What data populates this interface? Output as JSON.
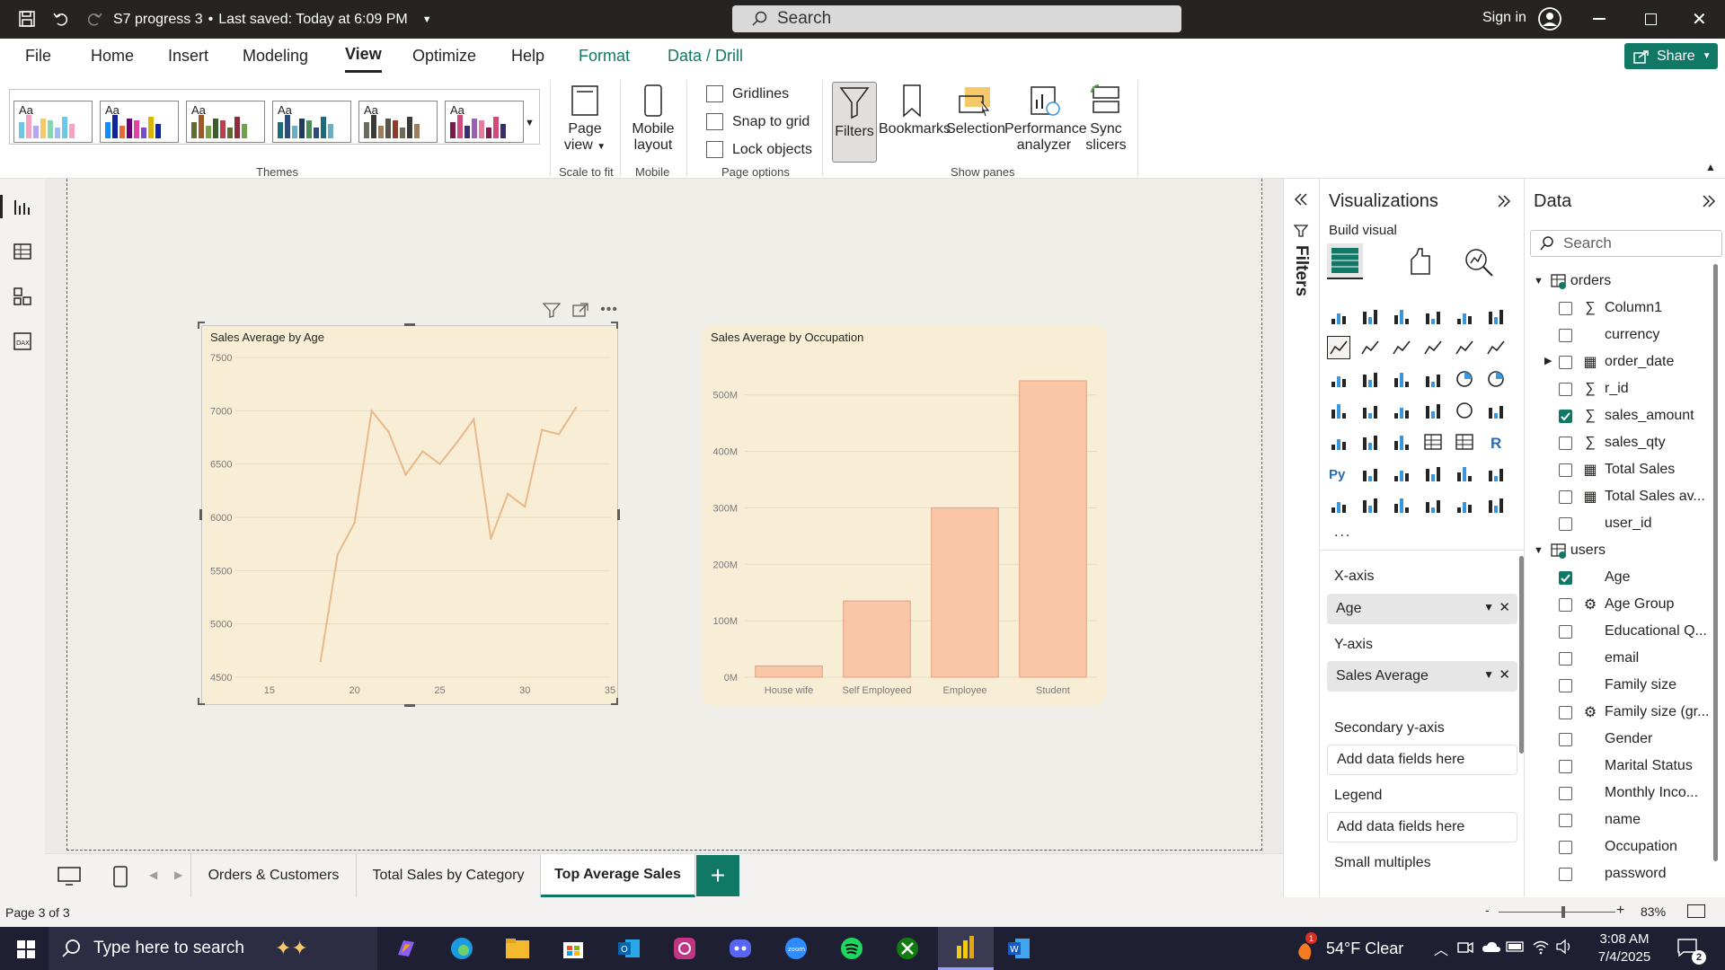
{
  "titlebar": {
    "file_title": "S7 progress 3",
    "saved_status": "Last saved: Today at 6:09 PM",
    "search_placeholder": "Search",
    "sign_in": "Sign in"
  },
  "menu": {
    "tabs": [
      "File",
      "Home",
      "Insert",
      "Modeling",
      "View",
      "Optimize",
      "Help",
      "Format",
      "Data / Drill"
    ],
    "active_tab": "View",
    "share_label": "Share"
  },
  "ribbon": {
    "themes_label": "Themes",
    "theme_aa": "Aa",
    "page_view": "Page view",
    "scale_to_fit": "Scale to fit",
    "mobile_layout": "Mobile layout",
    "mobile_label": "Mobile",
    "gridlines": "Gridlines",
    "snap_to_grid": "Snap to grid",
    "lock_objects": "Lock objects",
    "page_options": "Page options",
    "filters": "Filters",
    "bookmarks": "Bookmarks",
    "selection": "Selection",
    "performance": "Performance analyzer",
    "sync": "Sync slicers",
    "show_panes": "Show panes"
  },
  "visual_age": {
    "title": "Sales Average  by Age"
  },
  "visual_occupation": {
    "title": "Sales Average  by Occupation"
  },
  "chart_data": [
    {
      "type": "line",
      "title": "Sales Average  by Age",
      "xlabel": "",
      "ylabel": "",
      "x_ticks": [
        "15",
        "20",
        "25",
        "30",
        "35"
      ],
      "y_ticks": [
        "4500",
        "5000",
        "5500",
        "6000",
        "6500",
        "7000",
        "7500"
      ],
      "xlim": [
        13,
        35
      ],
      "ylim": [
        4500,
        7500
      ],
      "x": [
        18,
        19,
        20,
        21,
        22,
        23,
        24,
        25,
        26,
        27,
        28,
        29,
        30,
        31,
        32,
        33
      ],
      "values": [
        4650,
        5650,
        5950,
        7000,
        6800,
        6400,
        6620,
        6500,
        6700,
        6920,
        5800,
        6220,
        6100,
        6820,
        6780,
        7030
      ],
      "color": "#e8b98a",
      "grid": true
    },
    {
      "type": "bar",
      "title": "Sales Average  by Occupation",
      "categories": [
        "House wife",
        "Self Employeed",
        "Employee",
        "Student"
      ],
      "values": [
        20,
        135,
        300,
        525
      ],
      "y_ticks": [
        "0M",
        "100M",
        "200M",
        "300M",
        "400M",
        "500M"
      ],
      "ylim": [
        0,
        560
      ],
      "color": "#f9c6a7",
      "grid": true
    }
  ],
  "filters_label": "Filters",
  "viz": {
    "title": "Visualizations",
    "build_visual": "Build visual",
    "more": "...",
    "xaxis_label": "X-axis",
    "xaxis_field": "Age",
    "yaxis_label": "Y-axis",
    "yaxis_field": "Sales Average",
    "secondary_label": "Secondary y-axis",
    "legend_label": "Legend",
    "small_multiples_label": "Small multiples",
    "add_fields": "Add data fields here"
  },
  "data": {
    "title": "Data",
    "search_placeholder": "Search",
    "tables": [
      {
        "name": "orders",
        "fields": [
          {
            "name": "Column1",
            "icon": "sigma",
            "checked": false
          },
          {
            "name": "currency",
            "icon": "",
            "checked": false
          },
          {
            "name": "order_date",
            "icon": "table",
            "checked": false,
            "expandable": true
          },
          {
            "name": "r_id",
            "icon": "sigma",
            "checked": false
          },
          {
            "name": "sales_amount",
            "icon": "sigma",
            "checked": true
          },
          {
            "name": "sales_qty",
            "icon": "sigma",
            "checked": false
          },
          {
            "name": "Total Sales",
            "icon": "calc",
            "checked": false
          },
          {
            "name": "Total Sales av...",
            "icon": "calc",
            "checked": false
          },
          {
            "name": "user_id",
            "icon": "",
            "checked": false
          }
        ]
      },
      {
        "name": "users",
        "fields": [
          {
            "name": "Age",
            "icon": "",
            "checked": true
          },
          {
            "name": "Age Group",
            "icon": "group",
            "checked": false
          },
          {
            "name": "Educational Q...",
            "icon": "",
            "checked": false
          },
          {
            "name": "email",
            "icon": "",
            "checked": false
          },
          {
            "name": "Family size",
            "icon": "",
            "checked": false
          },
          {
            "name": "Family size (gr...",
            "icon": "group",
            "checked": false
          },
          {
            "name": "Gender",
            "icon": "",
            "checked": false
          },
          {
            "name": "Marital Status",
            "icon": "",
            "checked": false
          },
          {
            "name": "Monthly Inco...",
            "icon": "",
            "checked": false
          },
          {
            "name": "name",
            "icon": "",
            "checked": false
          },
          {
            "name": "Occupation",
            "icon": "",
            "checked": false
          },
          {
            "name": "password",
            "icon": "",
            "checked": false
          }
        ]
      }
    ]
  },
  "pages": {
    "tabs": [
      "Orders & Customers",
      "Total Sales by Category",
      "Top Average Sales"
    ],
    "active": "Top Average Sales",
    "add": "+"
  },
  "status": {
    "page_indicator": "Page 3 of 3",
    "zoom_minus": "-",
    "zoom_plus": "+",
    "zoom": "83%",
    "zoom_level": 0.83
  },
  "taskbar": {
    "search_placeholder": "Type here to search",
    "weather": "54°F  Clear",
    "weather_badge": "1",
    "time": "3:08 AM",
    "date": "7/4/2025",
    "notification_count": "2"
  }
}
